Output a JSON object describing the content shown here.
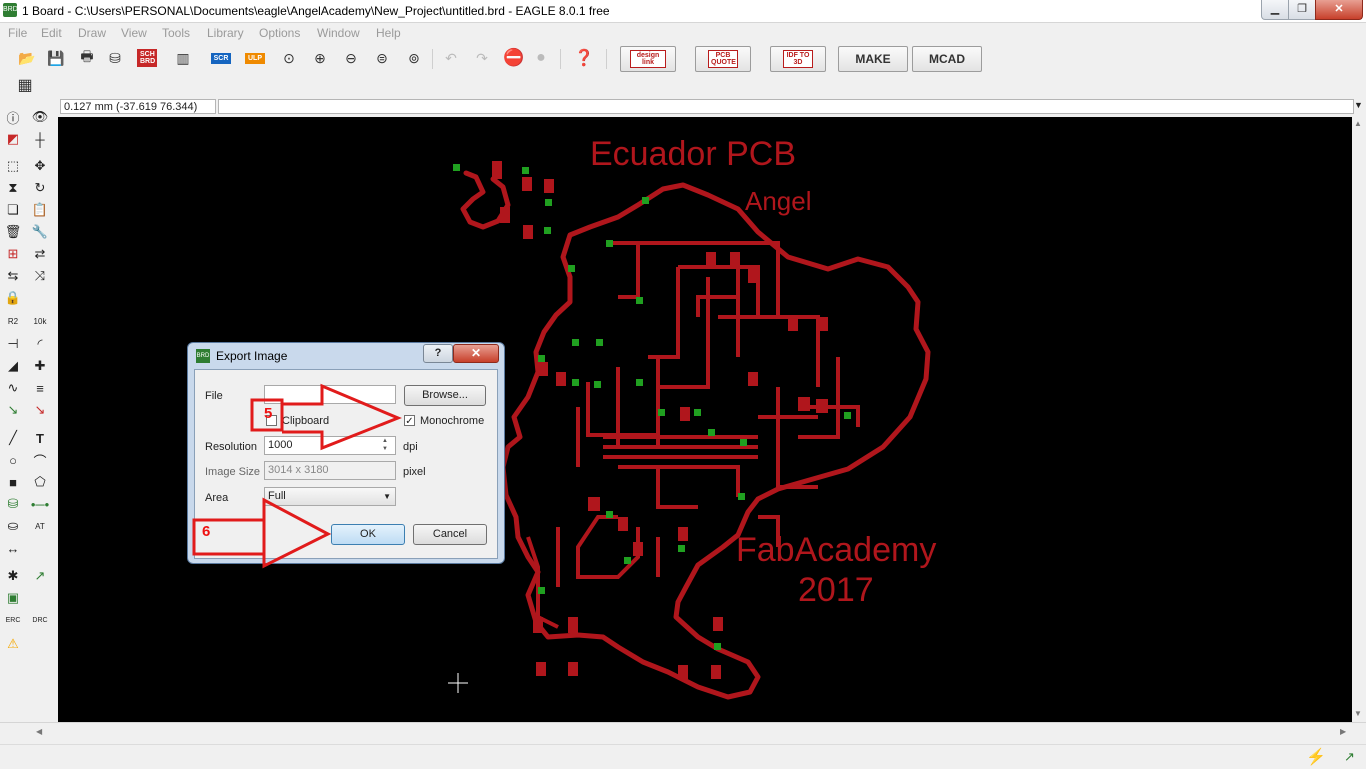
{
  "window": {
    "title": "1 Board - C:\\Users\\PERSONAL\\Documents\\eagle\\AngelAcademy\\New_Project\\untitled.brd - EAGLE 8.0.1 free",
    "app_icon": "BRD"
  },
  "menu": [
    "File",
    "Edit",
    "Draw",
    "View",
    "Tools",
    "Library",
    "Options",
    "Window",
    "Help"
  ],
  "toolbar": {
    "buttons": [
      "open-icon",
      "save-icon",
      "print-icon",
      "cam-icon",
      "sch-brd-icon",
      "library-icon",
      "scr-icon",
      "ulp-icon",
      "zoom-fit-icon",
      "zoom-in-icon",
      "zoom-out-icon",
      "zoom-redraw-icon",
      "zoom-select-icon",
      "undo-icon",
      "redo-icon",
      "stop-icon",
      "go-icon",
      "help-icon"
    ],
    "sch_brd": "SCH BRD",
    "scr": "SCR",
    "ulp": "ULP",
    "design_link": "design link",
    "pcb_quote": "PCB QUOTE",
    "idf": "IDF TO 3D",
    "make": "MAKE",
    "mcad": "MCAD"
  },
  "coord": "0.127 mm (-37.619 76.344)",
  "board_texts": {
    "title": "Ecuador PCB",
    "author": "Angel",
    "academy": "FabAcademy",
    "year": "2017"
  },
  "dialog": {
    "title": "Export Image",
    "icon": "BRD",
    "help": "?",
    "close": "✕",
    "file_label": "File",
    "file_value": "",
    "browse": "Browse...",
    "clipboard": "Clipboard",
    "clipboard_checked": false,
    "monochrome": "Monochrome",
    "monochrome_checked": true,
    "resolution_label": "Resolution",
    "resolution_value": "1000",
    "resolution_unit": "dpi",
    "image_size_label": "Image Size",
    "image_size_value": "3014 x 3180",
    "image_size_unit": "pixel",
    "area_label": "Area",
    "area_value": "Full",
    "ok": "OK",
    "cancel": "Cancel"
  },
  "annotations": {
    "step5": "5",
    "step6": "6",
    "color": "#e11b1b"
  },
  "colors": {
    "trace": "#b0161c",
    "via": "#20a020",
    "canvas": "#000000"
  }
}
